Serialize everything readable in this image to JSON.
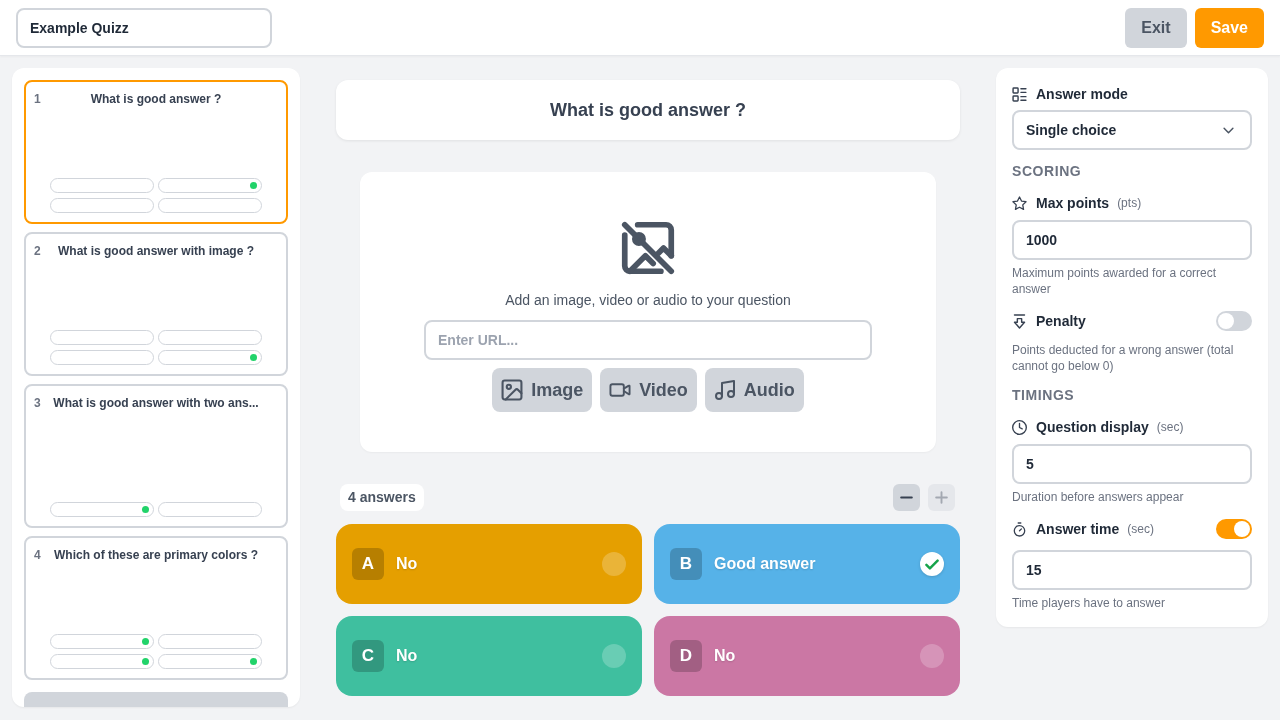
{
  "header": {
    "quiz_title": "Example Quizz",
    "buttons": [
      {
        "label": "Exit",
        "kind": "secondary"
      },
      {
        "label": "Save",
        "kind": "primary"
      }
    ]
  },
  "questions": [
    {
      "number": "1",
      "title": "What is good answer ?",
      "selected": true,
      "answers": [
        {
          "correct": false
        },
        {
          "correct": true
        },
        {
          "correct": false
        },
        {
          "correct": false
        }
      ]
    },
    {
      "number": "2",
      "title": "What is good answer with image ?",
      "selected": false,
      "answers": [
        {
          "correct": false
        },
        {
          "correct": false
        },
        {
          "correct": false
        },
        {
          "correct": true
        }
      ]
    },
    {
      "number": "3",
      "title": "What is good answer with two ans...",
      "selected": false,
      "answers": [
        {
          "correct": true
        },
        {
          "correct": false
        }
      ]
    },
    {
      "number": "4",
      "title": "Which of these are primary colors ?",
      "selected": false,
      "answers": [
        {
          "correct": true
        },
        {
          "correct": false
        },
        {
          "correct": true
        },
        {
          "correct": true
        }
      ]
    }
  ],
  "editor": {
    "question_title": "What is good answer ?",
    "media": {
      "prompt": "Add an image, video or audio to your question",
      "url_placeholder": "Enter URL...",
      "buttons": [
        {
          "label": "Image",
          "kind": "image"
        },
        {
          "label": "Video",
          "kind": "video"
        },
        {
          "label": "Audio",
          "kind": "audio"
        }
      ]
    },
    "answer_count": {
      "label": "4 answers",
      "can_decrease": true,
      "can_increase": false
    },
    "answers": [
      {
        "letter": "A",
        "text": "No",
        "color": "#e59f00",
        "correct": false
      },
      {
        "letter": "B",
        "text": "Good answer",
        "color": "#56b2e8",
        "correct": true
      },
      {
        "letter": "C",
        "text": "No",
        "color": "#3fbf9f",
        "correct": false
      },
      {
        "letter": "D",
        "text": "No",
        "color": "#cb77a4",
        "correct": false
      }
    ]
  },
  "settings": {
    "answer_mode": {
      "label": "Answer mode",
      "value": "Single choice"
    },
    "scoring": {
      "heading": "SCORING",
      "max_points": {
        "label": "Max points",
        "unit": "(pts)",
        "value": "1000",
        "help": "Maximum points awarded for a correct answer"
      },
      "penalty": {
        "label": "Penalty",
        "on": false,
        "help": "Points deducted for a wrong answer (total cannot go below 0)"
      }
    },
    "timings": {
      "heading": "TIMINGS",
      "question_display": {
        "label": "Question display",
        "unit": "(sec)",
        "value": "5",
        "help": "Duration before answers appear"
      },
      "answer_time": {
        "label": "Answer time",
        "unit": "(sec)",
        "on": true,
        "value": "15",
        "help": "Time players have to answer"
      }
    }
  }
}
